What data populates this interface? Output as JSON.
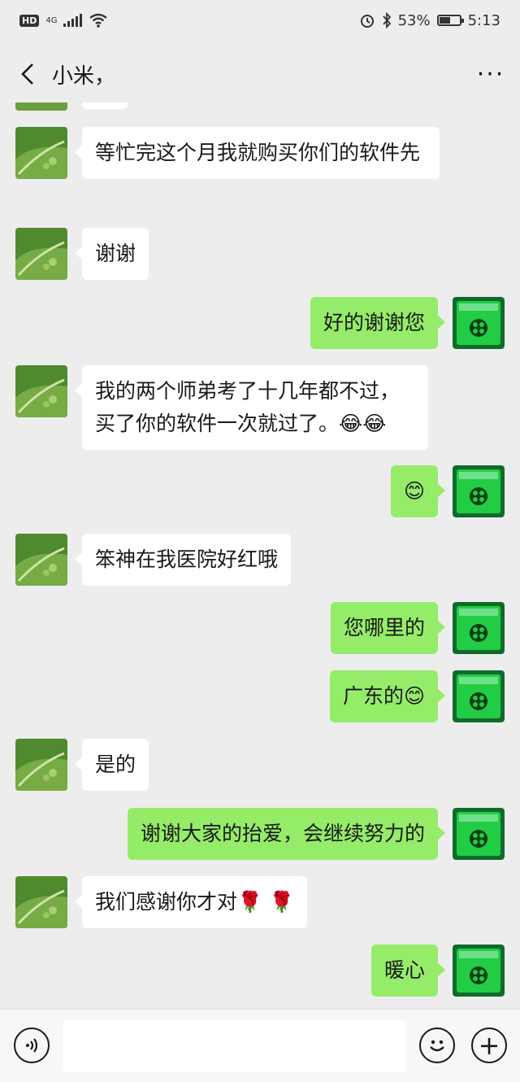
{
  "status_bar": {
    "hd": "HD",
    "network": "4G",
    "battery": "53%",
    "battery_level": 0.53,
    "time": "5:13",
    "icons": [
      "signal-icon",
      "wifi-icon",
      "alarm-icon",
      "bluetooth-icon",
      "battery-icon"
    ]
  },
  "nav": {
    "title": "小米，",
    "back_icon": "chevron-left-icon",
    "more_label": "···"
  },
  "messages": [
    {
      "side": "left",
      "text": "等忙完这个月我就购买你们的软件先"
    },
    {
      "side": "left",
      "text": "谢谢"
    },
    {
      "side": "right",
      "text": "好的谢谢您"
    },
    {
      "side": "left",
      "text": "我的两个师弟考了十几年都不过，买了你的软件一次就过了。😂😂"
    },
    {
      "side": "right",
      "text": "😊"
    },
    {
      "side": "left",
      "text": "笨神在我医院好红哦"
    },
    {
      "side": "right",
      "text": "您哪里的"
    },
    {
      "side": "right",
      "text": "广东的😊"
    },
    {
      "side": "left",
      "text": "是的"
    },
    {
      "side": "right",
      "text": "谢谢大家的抬爱，会继续努力的"
    },
    {
      "side": "left",
      "text": "我们感谢你才对🌹 🌹"
    },
    {
      "side": "right",
      "text": "暖心"
    }
  ],
  "input_bar": {
    "voice_icon": "voice-icon",
    "emoji_icon": "smiley-icon",
    "plus_icon": "plus-icon",
    "plus_label": "+",
    "input_value": ""
  },
  "colors": {
    "background": "#ededed",
    "sent_bubble": "#95ec69",
    "received_bubble": "#ffffff",
    "self_avatar": "#22cc44"
  }
}
